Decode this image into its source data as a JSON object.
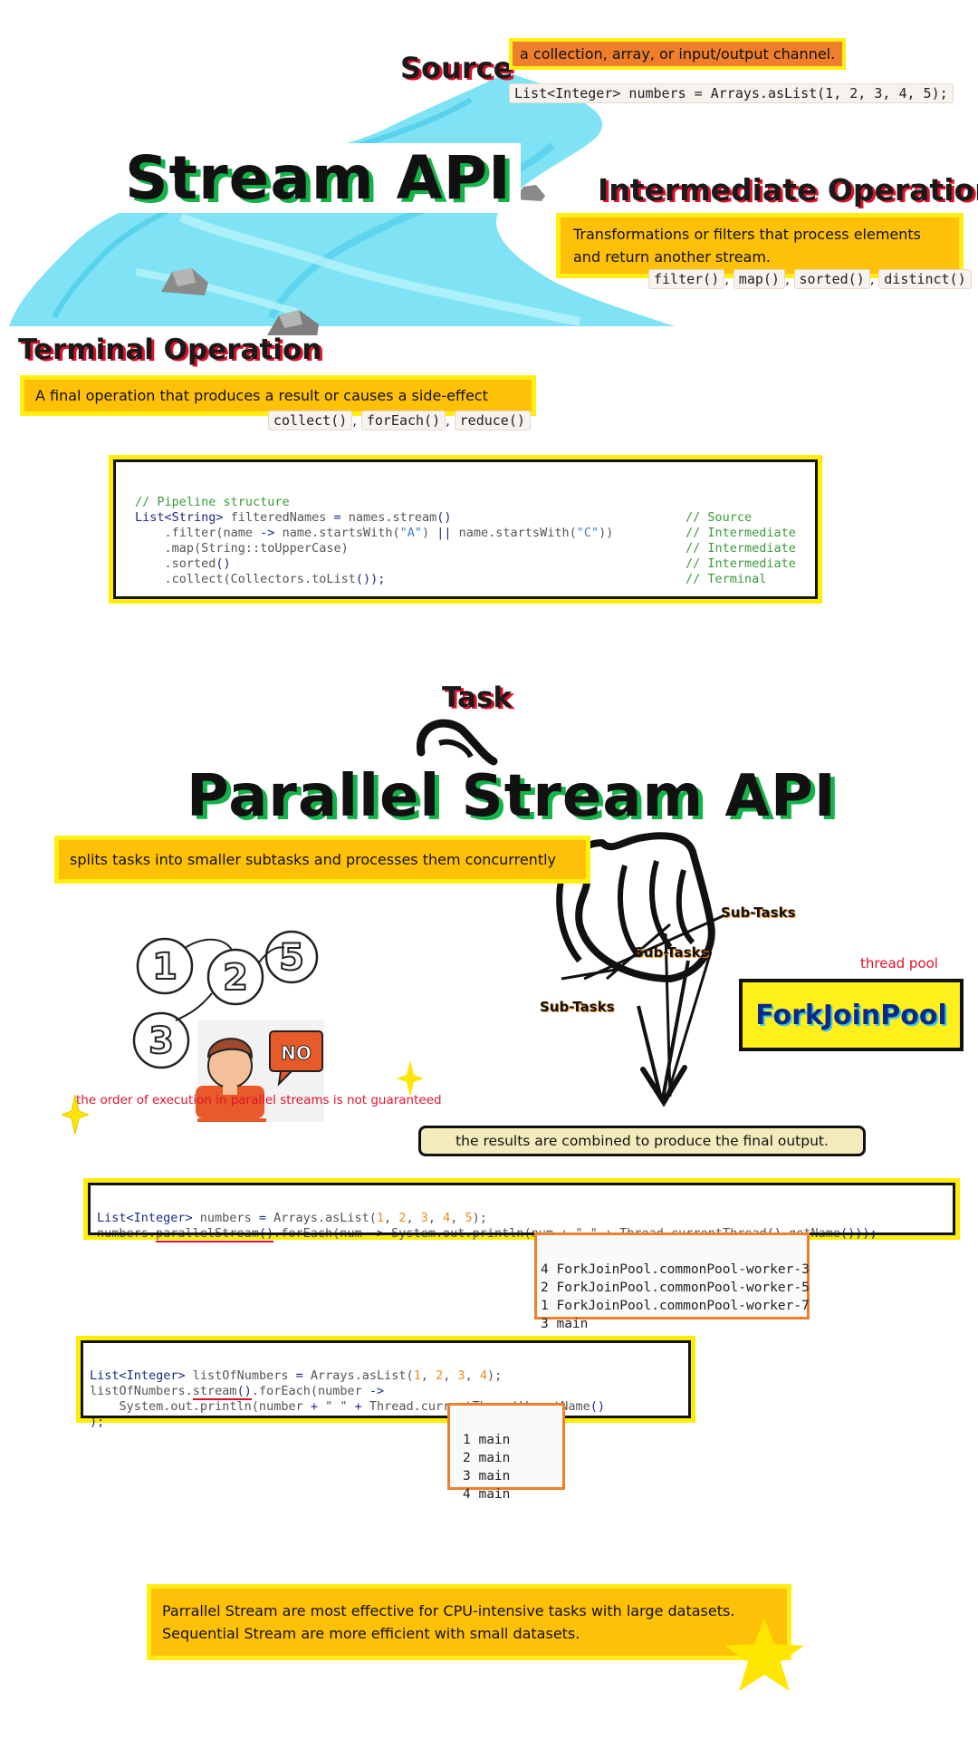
{
  "stream_section": {
    "title": "Stream API",
    "source": {
      "heading": "Source",
      "description": "a collection, array, or input/output channel.",
      "code": "List<Integer> numbers = Arrays.asList(1, 2, 3, 4, 5);"
    },
    "intermediate": {
      "heading": "Intermediate Operations",
      "description": "Transformations or filters that process elements and return another stream.",
      "methods": [
        "filter()",
        "map()",
        "sorted()",
        "distinct()"
      ]
    },
    "terminal": {
      "heading": "Terminal Operation",
      "description": "A final operation that produces a result or causes a side-effect",
      "methods": [
        "collect()",
        "forEach()",
        "reduce()"
      ]
    },
    "pipeline": {
      "comment": "// Pipeline structure",
      "line1_a": "List",
      "line1_b": "<String>",
      "line1_c": " filteredNames ",
      "line1_d": "=",
      "line1_e": " names.stream",
      "line1_f": "()",
      "line2_a": "    .filter(name ",
      "line2_b": "->",
      "line2_c": " name.startsWith(",
      "line2_d": "\"A\"",
      "line2_e": ") ",
      "line2_f": "||",
      "line2_g": " name.startsWith(",
      "line2_h": "\"C\"",
      "line2_i": "))",
      "line3": "    .map(String::toUpperCase)",
      "line4_a": "    .sorted",
      "line4_b": "()",
      "line5_a": "    .collect(Collectors.toList",
      "line5_b": "());",
      "comments": [
        "// Source",
        "// Intermediate",
        "// Intermediate",
        "// Intermediate",
        "// Terminal"
      ]
    }
  },
  "parallel_section": {
    "task_label": "Task",
    "title": "Parallel Stream API",
    "description": "splits tasks into smaller subtasks and processes them concurrently",
    "subtask_label": "Sub-Tasks",
    "thread_pool_label": "thread pool",
    "pool_name": "ForkJoinPool",
    "order_note": "the order of execution in parallel streams is not guaranteed",
    "no_badge": "NO",
    "ball_numbers": [
      "1",
      "2",
      "5",
      "3"
    ],
    "combine_note": "the results are combined to produce the final output.",
    "parallel_code": {
      "l1_a": "List",
      "l1_b": "<Integer>",
      "l1_c": " numbers ",
      "l1_d": "=",
      "l1_e": " Arrays.asList(",
      "l1_n": [
        "1",
        "2",
        "3",
        "4",
        "5"
      ],
      "l1_f": ");",
      "l2_a": "numbers.",
      "l2_b": "parallelStream",
      "l2_c": "()",
      "l2_d": ".forEach(num ",
      "l2_e": "->",
      "l2_f": " System.out.println(num ",
      "l2_g": "+",
      "l2_h": " \" \" ",
      "l2_i": "+",
      "l2_j": " Thread.currentThread",
      "l2_k": "().",
      "l2_l": "getName",
      "l2_m": "()));"
    },
    "parallel_output": [
      "4 ForkJoinPool.commonPool-worker-3",
      "2 ForkJoinPool.commonPool-worker-5",
      "1 ForkJoinPool.commonPool-worker-7",
      "3 main"
    ],
    "sequential_code": {
      "l1_a": "List",
      "l1_b": "<Integer>",
      "l1_c": " listOfNumbers ",
      "l1_d": "=",
      "l1_e": " Arrays.asList(",
      "l1_n": [
        "1",
        "2",
        "3",
        "4"
      ],
      "l1_f": ");",
      "l2_a": "listOfNumbers.",
      "l2_b": "stream",
      "l2_c": "()",
      "l2_d": ".forEach(number ",
      "l2_e": "->",
      "l3_a": "    System.out.println(number ",
      "l3_b": "+",
      "l3_c": " \" \" ",
      "l3_d": "+",
      "l3_e": " Thread.currentThread",
      "l3_f": "().",
      "l3_g": "getName",
      "l3_h": "()",
      "l4": ");"
    },
    "sequential_output": [
      "1 main",
      "2 main",
      "3 main",
      "4 main"
    ],
    "conclusion": [
      "Parrallel Stream are most effective for CPU-intensive tasks with large datasets.",
      "Sequential Stream are more efficient with small datasets."
    ]
  },
  "colors": {
    "accent_yellow": "#ffc107",
    "border_yellow": "#ffee11",
    "green_shadow": "#14b34a",
    "red_shadow": "#e0112b",
    "orange": "#f07f2b",
    "river": "#7fe3f5"
  }
}
